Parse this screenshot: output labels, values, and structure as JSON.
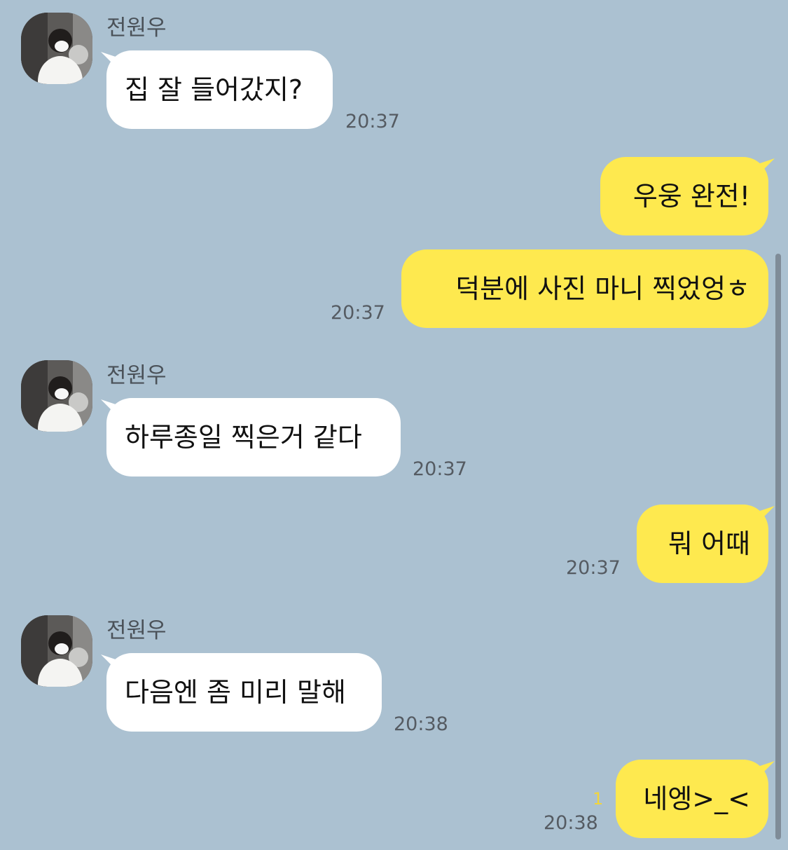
{
  "sender_name": "전원우",
  "colors": {
    "background": "#abc1d1",
    "incoming_bubble": "#ffffff",
    "outgoing_bubble": "#fee94f",
    "unread_count": "#f2d53a"
  },
  "messages": [
    {
      "direction": "in",
      "text": "집 잘 들어갔지?",
      "time": "20:37"
    },
    {
      "direction": "out",
      "text": "우웅 완전!",
      "time": ""
    },
    {
      "direction": "out",
      "text": "덕분에 사진 마니 찍었엉ㅎ",
      "time": "20:37"
    },
    {
      "direction": "in",
      "text": "하루종일 찍은거 같다",
      "time": "20:37"
    },
    {
      "direction": "out",
      "text": "뭐 어때",
      "time": "20:37"
    },
    {
      "direction": "in",
      "text": "다음엔 좀 미리 말해",
      "time": "20:38"
    },
    {
      "direction": "out",
      "text": "네엥>_<",
      "time": "20:38",
      "unread": "1"
    }
  ],
  "icons": {
    "avatar": "profile-photo"
  }
}
